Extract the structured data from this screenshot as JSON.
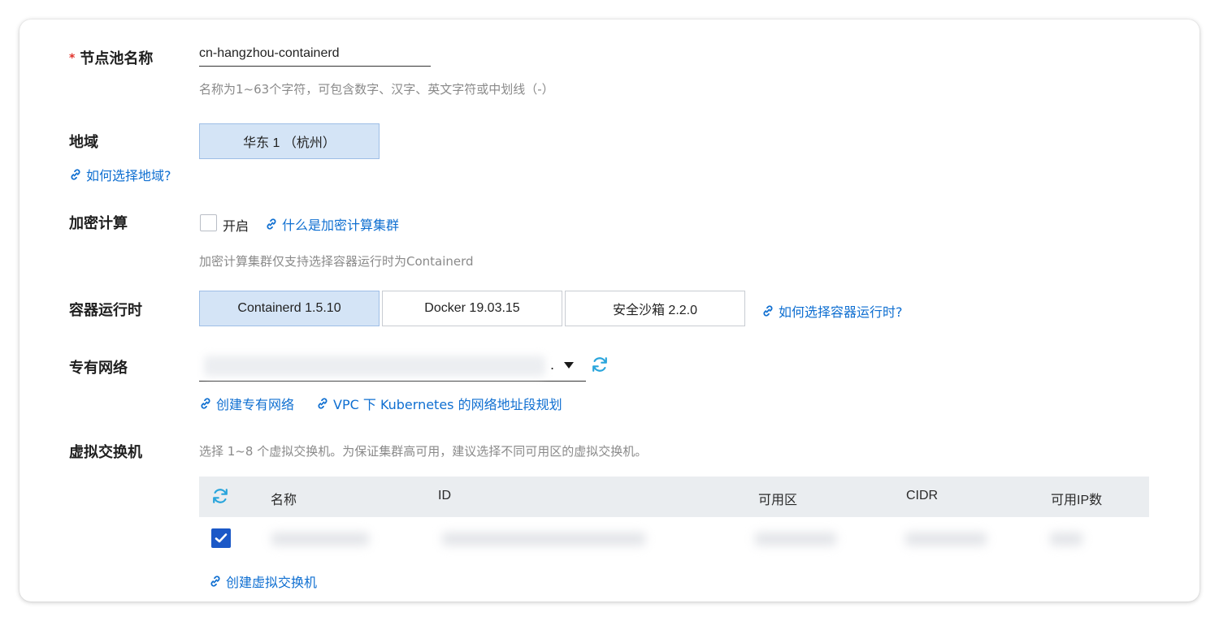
{
  "form": {
    "node_pool_name": {
      "required_mark": "*",
      "label": "节点池名称",
      "value": "cn-hangzhou-containerd",
      "hint": "名称为1~63个字符，可包含数字、汉字、英文字符或中划线（-）"
    },
    "region": {
      "label": "地域",
      "selected": "华东 1 （杭州）",
      "help_link": "如何选择地域?"
    },
    "encrypted_compute": {
      "label": "加密计算",
      "checkbox_label": "开启",
      "checked": false,
      "help_link": "什么是加密计算集群",
      "hint": "加密计算集群仅支持选择容器运行时为Containerd"
    },
    "container_runtime": {
      "label": "容器运行时",
      "options": [
        "Containerd 1.5.10",
        "Docker 19.03.15",
        "安全沙箱 2.2.0"
      ],
      "selected": "Containerd 1.5.10",
      "help_link": "如何选择容器运行时?"
    },
    "vpc": {
      "label": "专有网络",
      "value_suffix": ".",
      "links": [
        "创建专有网络",
        "VPC 下 Kubernetes 的网络地址段规划"
      ]
    },
    "vswitch": {
      "label": "虚拟交换机",
      "hint": "选择 1~8 个虚拟交换机。为保证集群高可用，建议选择不同可用区的虚拟交换机。",
      "table": {
        "columns": [
          "名称",
          "ID",
          "可用区",
          "CIDR",
          "可用IP数"
        ],
        "rows": [
          {
            "checked": true
          }
        ]
      },
      "create_link": "创建虚拟交换机"
    }
  },
  "colors": {
    "accent_link": "#0f6fd1",
    "required": "#e0322a",
    "segment_active_bg": "#d4e4f6",
    "checkbox_checked": "#1b58c7",
    "refresh_icon": "#29a5dc"
  },
  "icons": {
    "link": "link-icon",
    "refresh": "refresh-icon",
    "dropdown": "caret-down-icon",
    "check": "checkmark-icon"
  }
}
